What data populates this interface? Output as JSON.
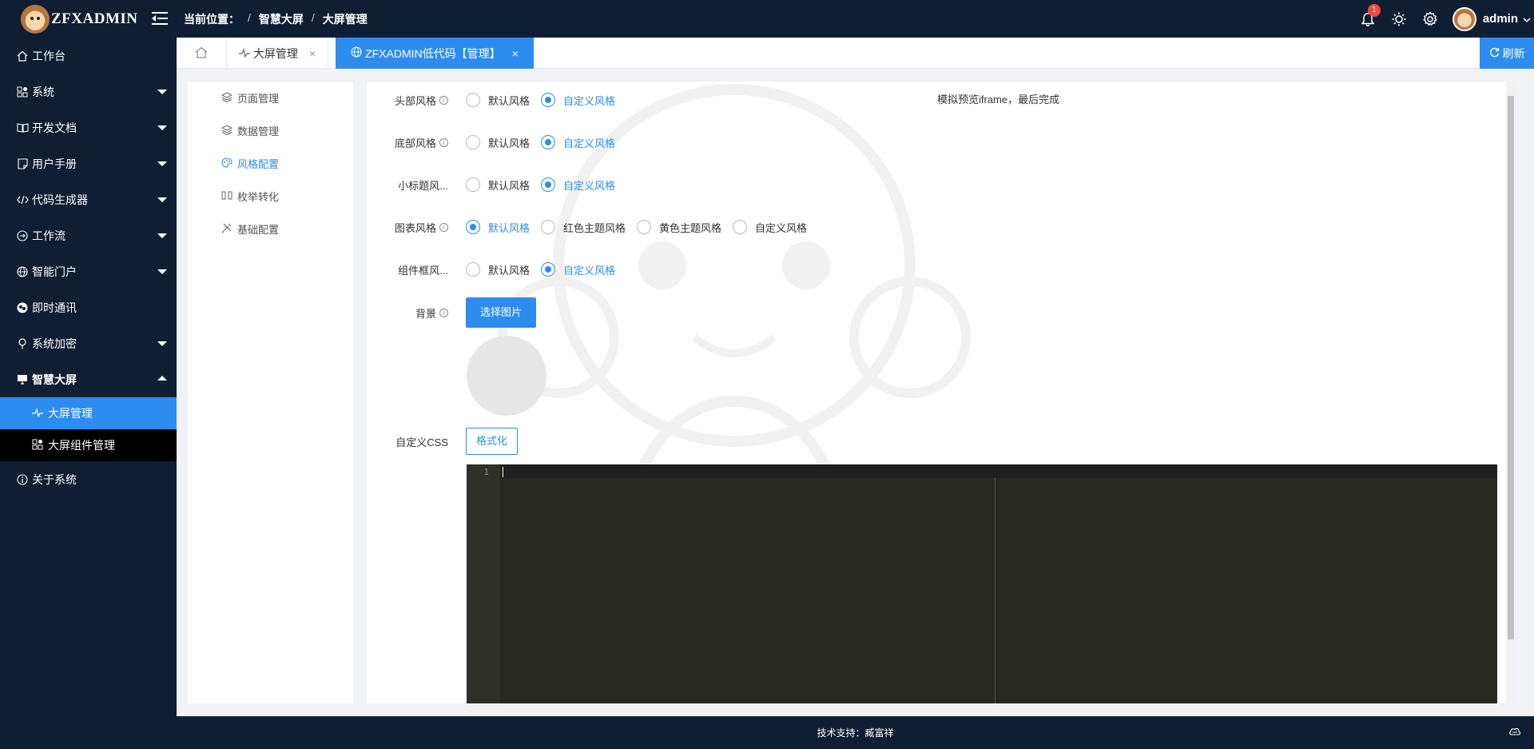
{
  "header": {
    "logo_text": "ZFXADMIN",
    "breadcrumb": [
      "当前位置：",
      "智慧大屏",
      "大屏管理"
    ],
    "notification_count": "1",
    "username": "admin"
  },
  "sidebar": {
    "items": [
      {
        "label": "工作台",
        "icon": "home-icon"
      },
      {
        "label": "系统",
        "icon": "apps-icon"
      },
      {
        "label": "开发文档",
        "icon": "book-icon"
      },
      {
        "label": "用户手册",
        "icon": "note-icon"
      },
      {
        "label": "代码生成器",
        "icon": "code-icon"
      },
      {
        "label": "工作流",
        "icon": "flow-icon"
      },
      {
        "label": "智能门户",
        "icon": "globe-icon"
      },
      {
        "label": "即时通讯",
        "icon": "chat-icon"
      },
      {
        "label": "系统加密",
        "icon": "lock-icon"
      },
      {
        "label": "智慧大屏",
        "icon": "monitor-icon"
      },
      {
        "label": "关于系统",
        "icon": "info-icon"
      }
    ],
    "submenu": [
      {
        "label": "大屏管理",
        "icon": "pulse-icon"
      },
      {
        "label": "大屏组件管理",
        "icon": "apps-icon"
      }
    ]
  },
  "tabs": {
    "items": [
      {
        "label": "大屏管理"
      },
      {
        "label": "ZFXADMIN低代码【管理】"
      }
    ],
    "refresh_label": "刷新"
  },
  "leftnav": {
    "items": [
      {
        "label": "页面管理",
        "icon": "layers-icon"
      },
      {
        "label": "数据管理",
        "icon": "layers-icon"
      },
      {
        "label": "风格配置",
        "icon": "palette-icon"
      },
      {
        "label": "枚举转化",
        "icon": "switch-icon"
      },
      {
        "label": "基础配置",
        "icon": "tools-icon"
      }
    ]
  },
  "form": {
    "header_style": {
      "label": "头部风格",
      "options": [
        "默认风格",
        "自定义风格"
      ],
      "selected": "自定义风格"
    },
    "footer_style": {
      "label": "底部风格",
      "options": [
        "默认风格",
        "自定义风格"
      ],
      "selected": "自定义风格"
    },
    "subtitle_style": {
      "label": "小标题风...",
      "options": [
        "默认风格",
        "自定义风格"
      ],
      "selected": "自定义风格"
    },
    "chart_style": {
      "label": "图表风格",
      "options": [
        "默认风格",
        "红色主题风格",
        "黄色主题风格",
        "自定义风格"
      ],
      "selected": "默认风格"
    },
    "component_frame_style": {
      "label": "组件框风...",
      "options": [
        "默认风格",
        "自定义风格"
      ],
      "selected": "自定义风格"
    },
    "background": {
      "label": "背景",
      "button_label": "选择图片"
    },
    "custom_css": {
      "label": "自定义CSS",
      "button_label": "格式化",
      "line_number": "1"
    }
  },
  "preview_note": "模拟预览iframe，最后完成",
  "footer": {
    "text": "技术支持：臧富祥"
  },
  "colors": {
    "primary": "#2d8cf0",
    "dark_bg": "#0f1e33",
    "editor_bg": "#272822",
    "badge": "#f5483b"
  }
}
